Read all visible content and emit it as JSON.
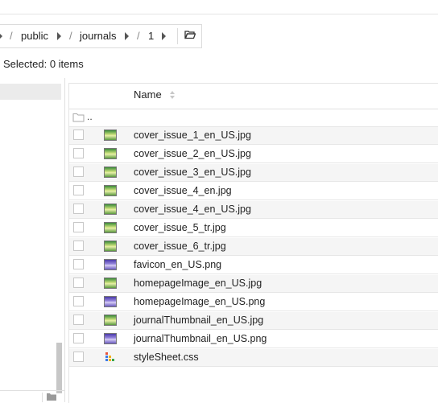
{
  "breadcrumb": {
    "items": [
      "public",
      "journals",
      "1"
    ],
    "separator": "/"
  },
  "status": {
    "selected": "Selected: 0 items"
  },
  "table": {
    "header": {
      "name": "Name"
    },
    "parent": "..",
    "files": [
      {
        "name": "cover_issue_1_en_US.jpg",
        "type": "jpg"
      },
      {
        "name": "cover_issue_2_en_US.jpg",
        "type": "jpg"
      },
      {
        "name": "cover_issue_3_en_US.jpg",
        "type": "jpg"
      },
      {
        "name": "cover_issue_4_en.jpg",
        "type": "jpg"
      },
      {
        "name": "cover_issue_4_en_US.jpg",
        "type": "jpg"
      },
      {
        "name": "cover_issue_5_tr.jpg",
        "type": "jpg"
      },
      {
        "name": "cover_issue_6_tr.jpg",
        "type": "jpg"
      },
      {
        "name": "favicon_en_US.png",
        "type": "png"
      },
      {
        "name": "homepageImage_en_US.jpg",
        "type": "jpg"
      },
      {
        "name": "homepageImage_en_US.png",
        "type": "png"
      },
      {
        "name": "journalThumbnail_en_US.jpg",
        "type": "jpg"
      },
      {
        "name": "journalThumbnail_en_US.png",
        "type": "png"
      },
      {
        "name": "styleSheet.css",
        "type": "css"
      }
    ]
  }
}
